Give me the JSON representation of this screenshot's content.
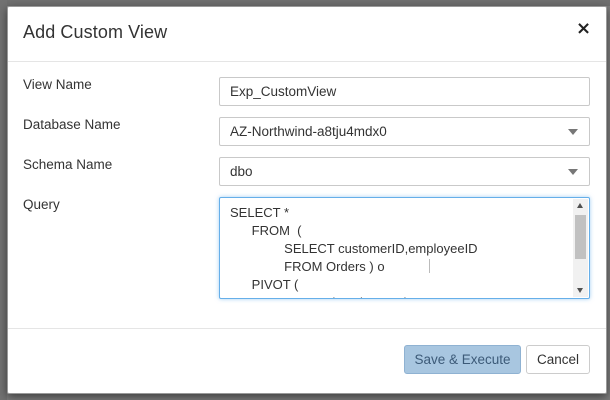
{
  "dialog": {
    "title": "Add Custom View",
    "close_glyph": "×"
  },
  "form": {
    "view_name": {
      "label": "View Name",
      "value": "Exp_CustomView"
    },
    "database_name": {
      "label": "Database Name",
      "value": "AZ-Northwind-a8tju4mdx0"
    },
    "schema_name": {
      "label": "Schema Name",
      "value": "dbo"
    },
    "query": {
      "label": "Query",
      "value": "SELECT *\n      FROM  (\n               SELECT customerID,employeeID\n               FROM Orders ) o\n      PIVOT (\n               COUNT(employeeID)"
    }
  },
  "footer": {
    "save_label": "Save & Execute",
    "cancel_label": "Cancel"
  },
  "colors": {
    "primary_button": "#a8c6e0",
    "focus_border": "#66afe9",
    "backdrop": "#7d7d7d"
  },
  "icons": {
    "close": "close-icon",
    "select_caret": "chevron-down-icon"
  }
}
